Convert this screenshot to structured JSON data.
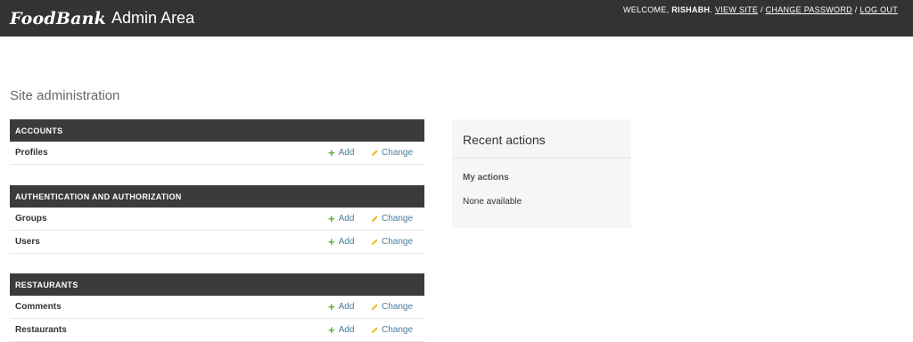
{
  "branding": {
    "script": "FoodBank",
    "rest": "Admin Area"
  },
  "user_tools": {
    "welcome": "WELCOME,",
    "user": "RISHABH",
    "view_site": "VIEW SITE",
    "change_password": "CHANGE PASSWORD",
    "log_out": "LOG OUT",
    "separator": "/"
  },
  "page_title": "Site administration",
  "modules": [
    {
      "caption": "ACCOUNTS",
      "rows": [
        {
          "name": "Profiles",
          "add": "Add",
          "change": "Change"
        }
      ]
    },
    {
      "caption": "AUTHENTICATION AND AUTHORIZATION",
      "rows": [
        {
          "name": "Groups",
          "add": "Add",
          "change": "Change"
        },
        {
          "name": "Users",
          "add": "Add",
          "change": "Change"
        }
      ]
    },
    {
      "caption": "RESTAURANTS",
      "rows": [
        {
          "name": "Comments",
          "add": "Add",
          "change": "Change"
        },
        {
          "name": "Restaurants",
          "add": "Add",
          "change": "Change"
        }
      ]
    }
  ],
  "recent_actions": {
    "title": "Recent actions",
    "subtitle": "My actions",
    "empty": "None available"
  },
  "colors": {
    "header_bg": "#333333",
    "caption_bg": "#3b3b3b",
    "add_icon": "#5ab12c",
    "change_icon": "#efb80b",
    "link": "#447e9b"
  }
}
